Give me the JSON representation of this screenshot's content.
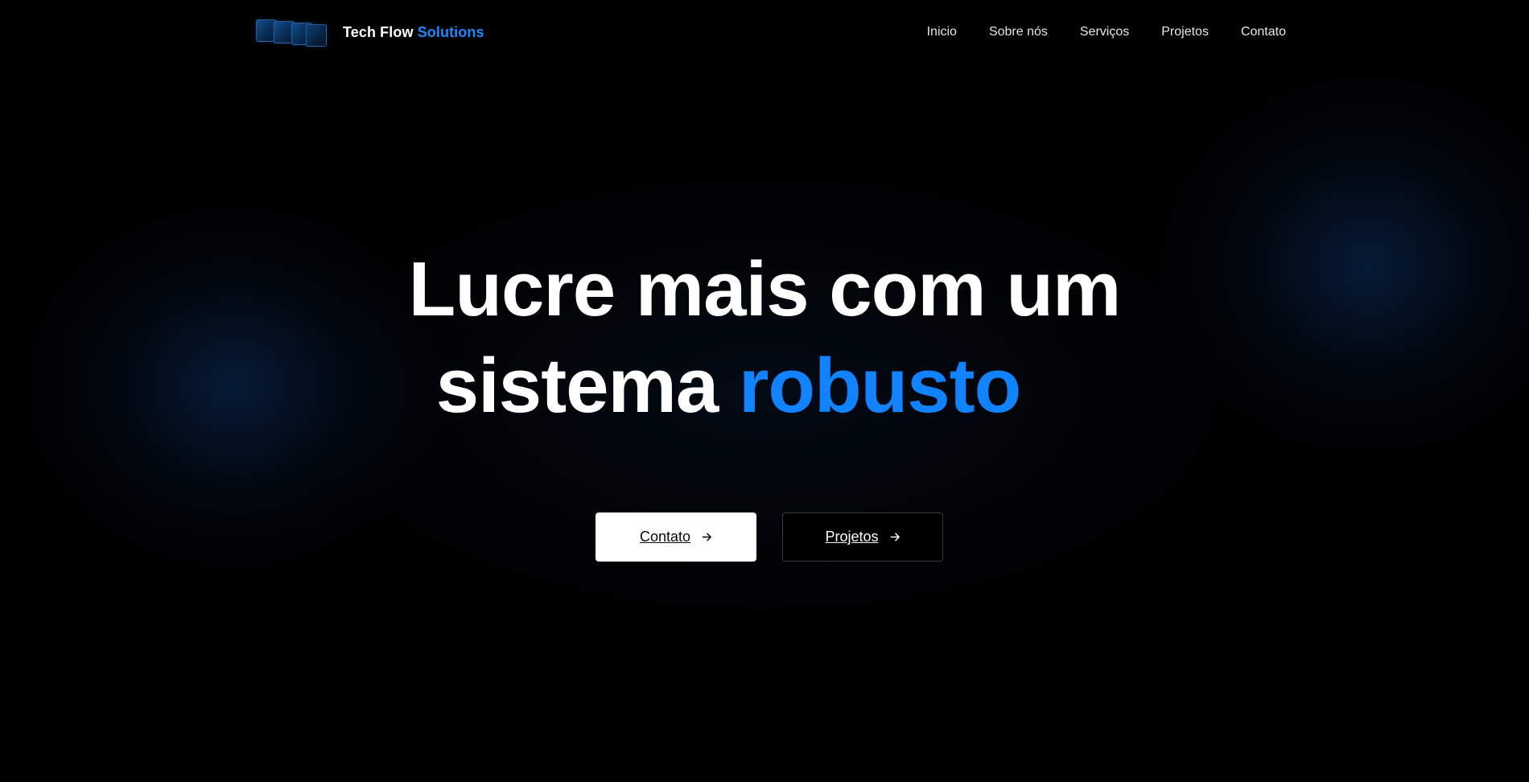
{
  "brand": {
    "name_part1": "Tech Flow",
    "name_part2": "Solutions",
    "logo_icon": "stacked-tiles-logo"
  },
  "nav": {
    "items": [
      {
        "label": "Inicio"
      },
      {
        "label": "Sobre nós"
      },
      {
        "label": "Serviços"
      },
      {
        "label": "Projetos"
      },
      {
        "label": "Contato"
      }
    ]
  },
  "hero": {
    "line1": "Lucre mais com um",
    "line2_plain": "sistema",
    "line2_accent": "robusto"
  },
  "cta": {
    "primary_label": "Contato",
    "secondary_label": "Projetos",
    "arrow_icon": "arrow-right-icon"
  },
  "colors": {
    "background": "#000000",
    "accent": "#1183ff",
    "brand_accent": "#1e88ff",
    "glow": "#0c3062",
    "primary_button_bg": "#ffffff",
    "secondary_button_border": "#3a3a3a"
  }
}
